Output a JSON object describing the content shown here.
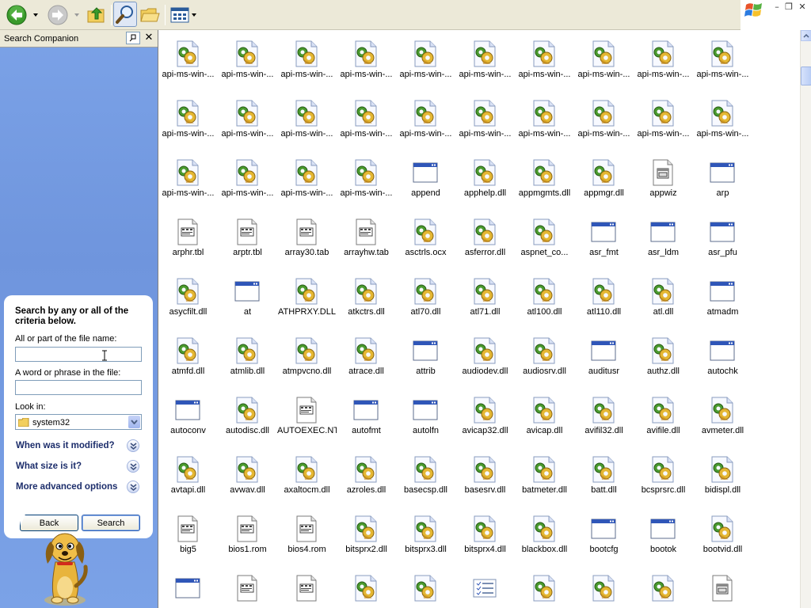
{
  "toolbar": {
    "icons": [
      "back-arrow-icon",
      "forward-arrow-icon",
      "up-folder-icon",
      "search-icon",
      "folders-icon",
      "views-icon"
    ],
    "colors": {
      "back": "#3a9a2b",
      "forward_disabled": "#b8b8b8",
      "folder": "#f2cf5e"
    }
  },
  "pane": {
    "title": "Search Companion",
    "heading": "Search by any or all of the criteria below.",
    "filename_label": "All or part of the file name:",
    "filename_value": "",
    "phrase_label": "A word or phrase in the file:",
    "phrase_value": "",
    "lookin_label": "Look in:",
    "lookin_value": "system32",
    "modified_label": "When was it modified?",
    "size_label": "What size is it?",
    "advanced_label": "More advanced options",
    "back_label": "Back",
    "search_label": "Search"
  },
  "files": [
    {
      "name": "api-ms-win-...",
      "icon": "dll"
    },
    {
      "name": "api-ms-win-...",
      "icon": "dll"
    },
    {
      "name": "api-ms-win-...",
      "icon": "dll"
    },
    {
      "name": "api-ms-win-...",
      "icon": "dll"
    },
    {
      "name": "api-ms-win-...",
      "icon": "dll"
    },
    {
      "name": "api-ms-win-...",
      "icon": "dll"
    },
    {
      "name": "api-ms-win-...",
      "icon": "dll"
    },
    {
      "name": "api-ms-win-...",
      "icon": "dll"
    },
    {
      "name": "api-ms-win-...",
      "icon": "dll"
    },
    {
      "name": "api-ms-win-...",
      "icon": "dll"
    },
    {
      "name": "api-ms-win-...",
      "icon": "dll"
    },
    {
      "name": "api-ms-win-...",
      "icon": "dll"
    },
    {
      "name": "api-ms-win-...",
      "icon": "dll"
    },
    {
      "name": "api-ms-win-...",
      "icon": "dll"
    },
    {
      "name": "api-ms-win-...",
      "icon": "dll"
    },
    {
      "name": "api-ms-win-...",
      "icon": "dll"
    },
    {
      "name": "api-ms-win-...",
      "icon": "dll"
    },
    {
      "name": "api-ms-win-...",
      "icon": "dll"
    },
    {
      "name": "api-ms-win-...",
      "icon": "dll"
    },
    {
      "name": "api-ms-win-...",
      "icon": "dll"
    },
    {
      "name": "api-ms-win-...",
      "icon": "dll"
    },
    {
      "name": "api-ms-win-...",
      "icon": "dll"
    },
    {
      "name": "api-ms-win-...",
      "icon": "dll"
    },
    {
      "name": "api-ms-win-...",
      "icon": "dll"
    },
    {
      "name": "append",
      "icon": "exe"
    },
    {
      "name": "apphelp.dll",
      "icon": "dll"
    },
    {
      "name": "appmgmts.dll",
      "icon": "dll"
    },
    {
      "name": "appmgr.dll",
      "icon": "dll"
    },
    {
      "name": "appwiz",
      "icon": "cpl"
    },
    {
      "name": "arp",
      "icon": "exe"
    },
    {
      "name": "arphr.tbl",
      "icon": "doc"
    },
    {
      "name": "arptr.tbl",
      "icon": "doc"
    },
    {
      "name": "array30.tab",
      "icon": "doc"
    },
    {
      "name": "arrayhw.tab",
      "icon": "doc"
    },
    {
      "name": "asctrls.ocx",
      "icon": "dll"
    },
    {
      "name": "asferror.dll",
      "icon": "dll"
    },
    {
      "name": "aspnet_co...",
      "icon": "dll"
    },
    {
      "name": "asr_fmt",
      "icon": "exe"
    },
    {
      "name": "asr_ldm",
      "icon": "exe"
    },
    {
      "name": "asr_pfu",
      "icon": "exe"
    },
    {
      "name": "asycfilt.dll",
      "icon": "dll"
    },
    {
      "name": "at",
      "icon": "exe"
    },
    {
      "name": "ATHPRXY.DLL",
      "icon": "dll"
    },
    {
      "name": "atkctrs.dll",
      "icon": "dll"
    },
    {
      "name": "atl70.dll",
      "icon": "dll"
    },
    {
      "name": "atl71.dll",
      "icon": "dll"
    },
    {
      "name": "atl100.dll",
      "icon": "dll"
    },
    {
      "name": "atl110.dll",
      "icon": "dll"
    },
    {
      "name": "atl.dll",
      "icon": "dll"
    },
    {
      "name": "atmadm",
      "icon": "exe"
    },
    {
      "name": "atmfd.dll",
      "icon": "dll"
    },
    {
      "name": "atmlib.dll",
      "icon": "dll"
    },
    {
      "name": "atmpvcno.dll",
      "icon": "dll"
    },
    {
      "name": "atrace.dll",
      "icon": "dll"
    },
    {
      "name": "attrib",
      "icon": "exe"
    },
    {
      "name": "audiodev.dll",
      "icon": "dll"
    },
    {
      "name": "audiosrv.dll",
      "icon": "dll"
    },
    {
      "name": "auditusr",
      "icon": "exe"
    },
    {
      "name": "authz.dll",
      "icon": "dll"
    },
    {
      "name": "autochk",
      "icon": "exe"
    },
    {
      "name": "autoconv",
      "icon": "exe"
    },
    {
      "name": "autodisc.dll",
      "icon": "dll"
    },
    {
      "name": "AUTOEXEC.NT",
      "icon": "doc"
    },
    {
      "name": "autofmt",
      "icon": "exe"
    },
    {
      "name": "autolfn",
      "icon": "exe"
    },
    {
      "name": "avicap32.dll",
      "icon": "dll"
    },
    {
      "name": "avicap.dll",
      "icon": "dll"
    },
    {
      "name": "avifil32.dll",
      "icon": "dll"
    },
    {
      "name": "avifile.dll",
      "icon": "dll"
    },
    {
      "name": "avmeter.dll",
      "icon": "dll"
    },
    {
      "name": "avtapi.dll",
      "icon": "dll"
    },
    {
      "name": "avwav.dll",
      "icon": "dll"
    },
    {
      "name": "axaltocm.dll",
      "icon": "dll"
    },
    {
      "name": "azroles.dll",
      "icon": "dll"
    },
    {
      "name": "basecsp.dll",
      "icon": "dll"
    },
    {
      "name": "basesrv.dll",
      "icon": "dll"
    },
    {
      "name": "batmeter.dll",
      "icon": "dll"
    },
    {
      "name": "batt.dll",
      "icon": "dll"
    },
    {
      "name": "bcsprsrc.dll",
      "icon": "dll"
    },
    {
      "name": "bidispl.dll",
      "icon": "dll"
    },
    {
      "name": "big5",
      "icon": "doc"
    },
    {
      "name": "bios1.rom",
      "icon": "doc"
    },
    {
      "name": "bios4.rom",
      "icon": "doc"
    },
    {
      "name": "bitsprx2.dll",
      "icon": "dll"
    },
    {
      "name": "bitsprx3.dll",
      "icon": "dll"
    },
    {
      "name": "bitsprx4.dll",
      "icon": "dll"
    },
    {
      "name": "blackbox.dll",
      "icon": "dll"
    },
    {
      "name": "bootcfg",
      "icon": "exe"
    },
    {
      "name": "bootok",
      "icon": "exe"
    },
    {
      "name": "bootvid.dll",
      "icon": "dll"
    },
    {
      "name": "",
      "icon": "exe"
    },
    {
      "name": "",
      "icon": "doc"
    },
    {
      "name": "",
      "icon": "doc"
    },
    {
      "name": "",
      "icon": "dll"
    },
    {
      "name": "",
      "icon": "dll"
    },
    {
      "name": "",
      "icon": "list"
    },
    {
      "name": "",
      "icon": "dll"
    },
    {
      "name": "",
      "icon": "dll"
    },
    {
      "name": "",
      "icon": "dll"
    },
    {
      "name": "",
      "icon": "cpl"
    }
  ]
}
